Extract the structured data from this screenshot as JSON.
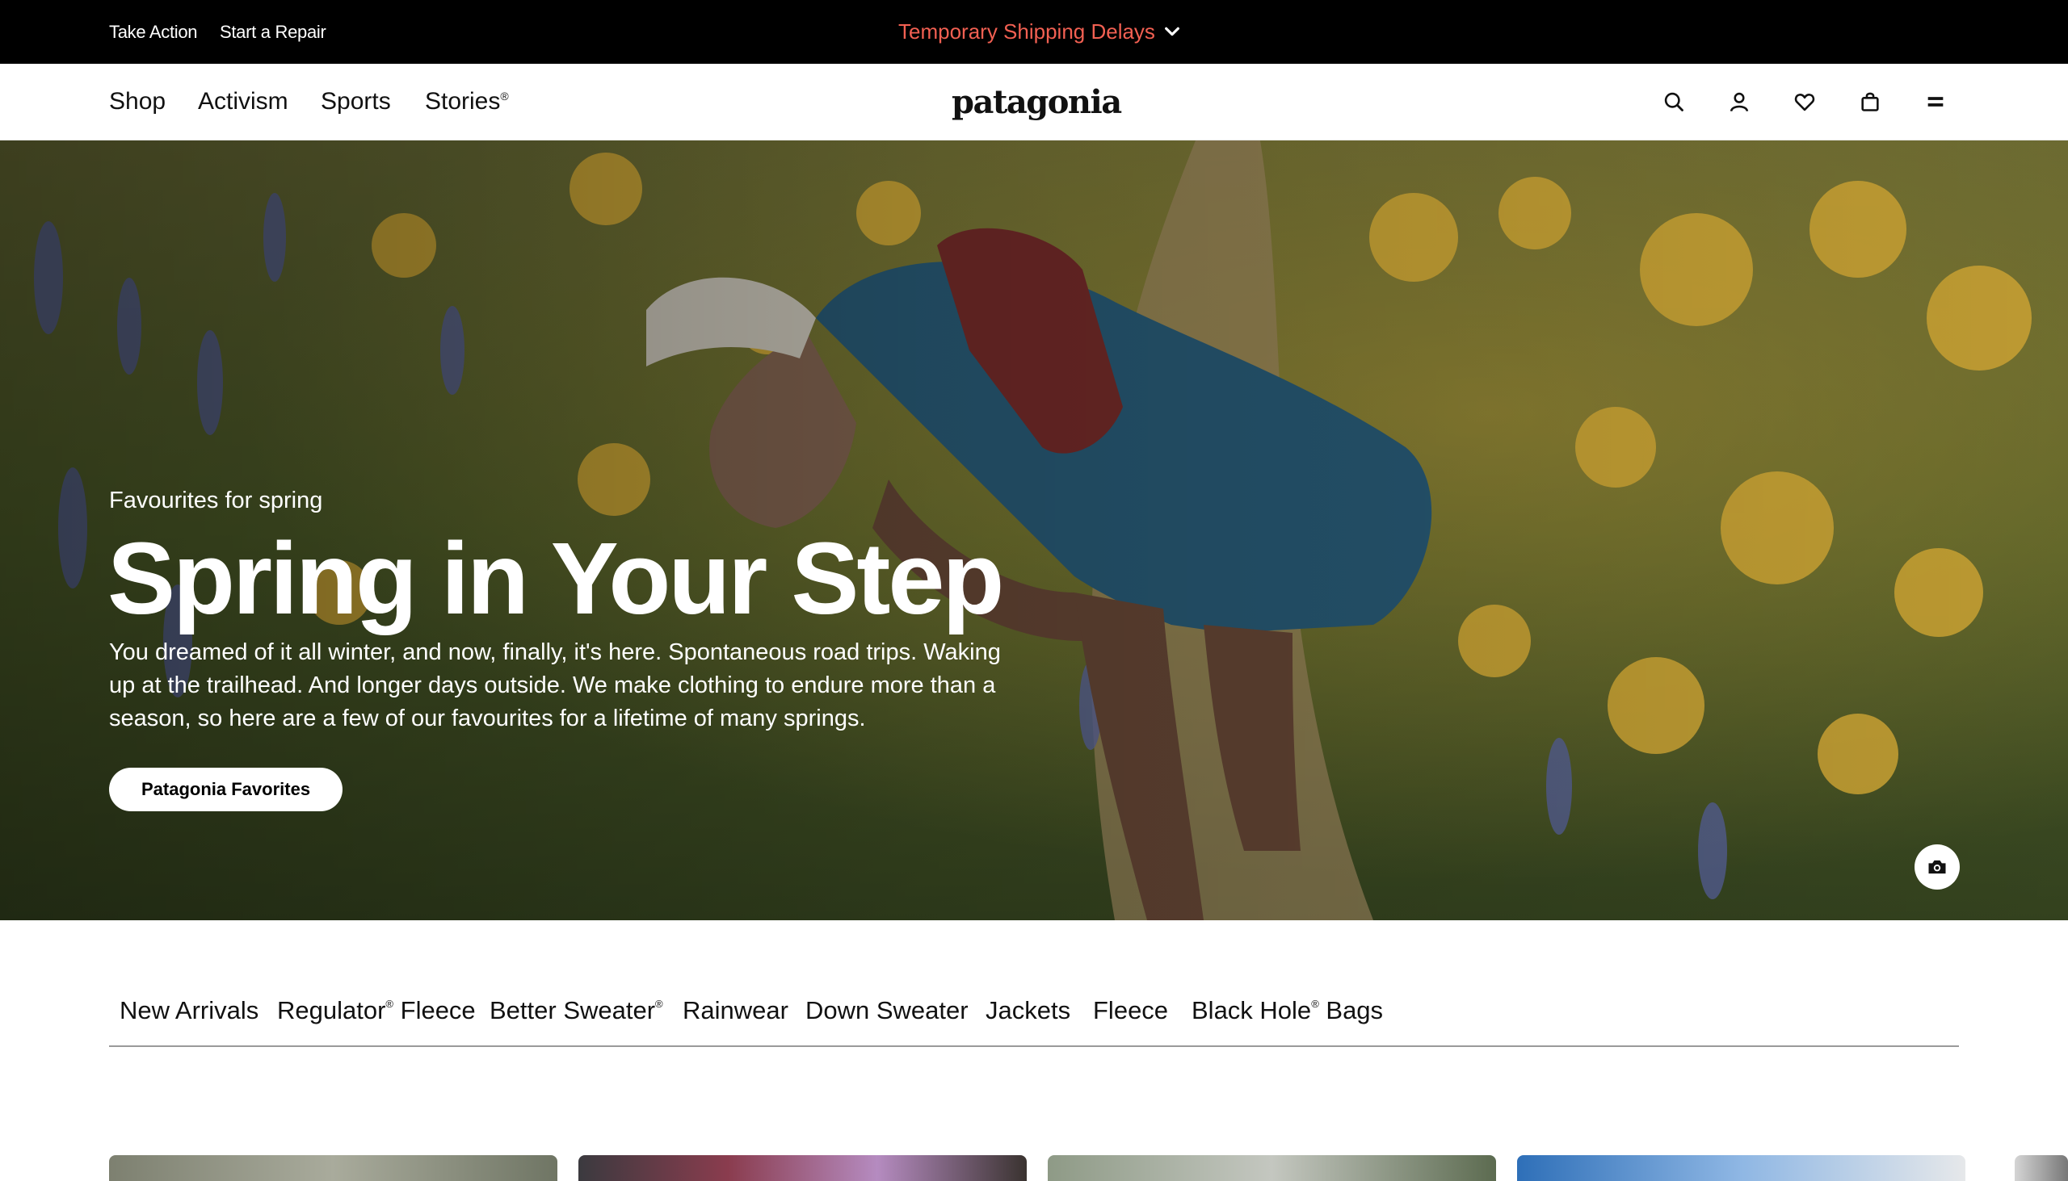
{
  "utility_bar": {
    "links": [
      "Take Action",
      "Start a Repair"
    ],
    "alert": "Temporary Shipping Delays",
    "alert_color": "#f26052"
  },
  "header": {
    "nav": [
      {
        "label": "Shop",
        "sup": ""
      },
      {
        "label": "Activism",
        "sup": ""
      },
      {
        "label": "Sports",
        "sup": ""
      },
      {
        "label": "Stories",
        "sup": "®"
      }
    ],
    "logo": "patagonia",
    "icons": [
      "search-icon",
      "account-icon",
      "wishlist-heart-icon",
      "shopping-bag-icon",
      "menu-icon"
    ]
  },
  "hero": {
    "eyebrow": "Favourites for spring",
    "title": "Spring in Your Step",
    "body": "You dreamed of it all winter, and now, finally, it's here. Spontaneous road trips. Waking up at the trailhead. And longer days outside. We make clothing to endure more than a season, so here are a few of our favourites for a lifetime of many springs.",
    "cta": "Patagonia Favorites",
    "camera_icon": "camera-icon"
  },
  "category_tabs": [
    {
      "label": "New Arrivals",
      "sup": ""
    },
    {
      "label": "Regulator",
      "sup": "®",
      "suffix": " Fleece"
    },
    {
      "label": "Better Sweater",
      "sup": "®",
      "suffix": ""
    },
    {
      "label": "Rainwear",
      "sup": ""
    },
    {
      "label": "Down Sweater",
      "sup": ""
    },
    {
      "label": "Jackets",
      "sup": ""
    },
    {
      "label": "Fleece",
      "sup": ""
    },
    {
      "label": "Black Hole",
      "sup": "®",
      "suffix": " Bags"
    }
  ],
  "colors": {
    "topbar_bg": "#000000",
    "alert_text": "#f26052",
    "page_bg": "#ffffff"
  }
}
